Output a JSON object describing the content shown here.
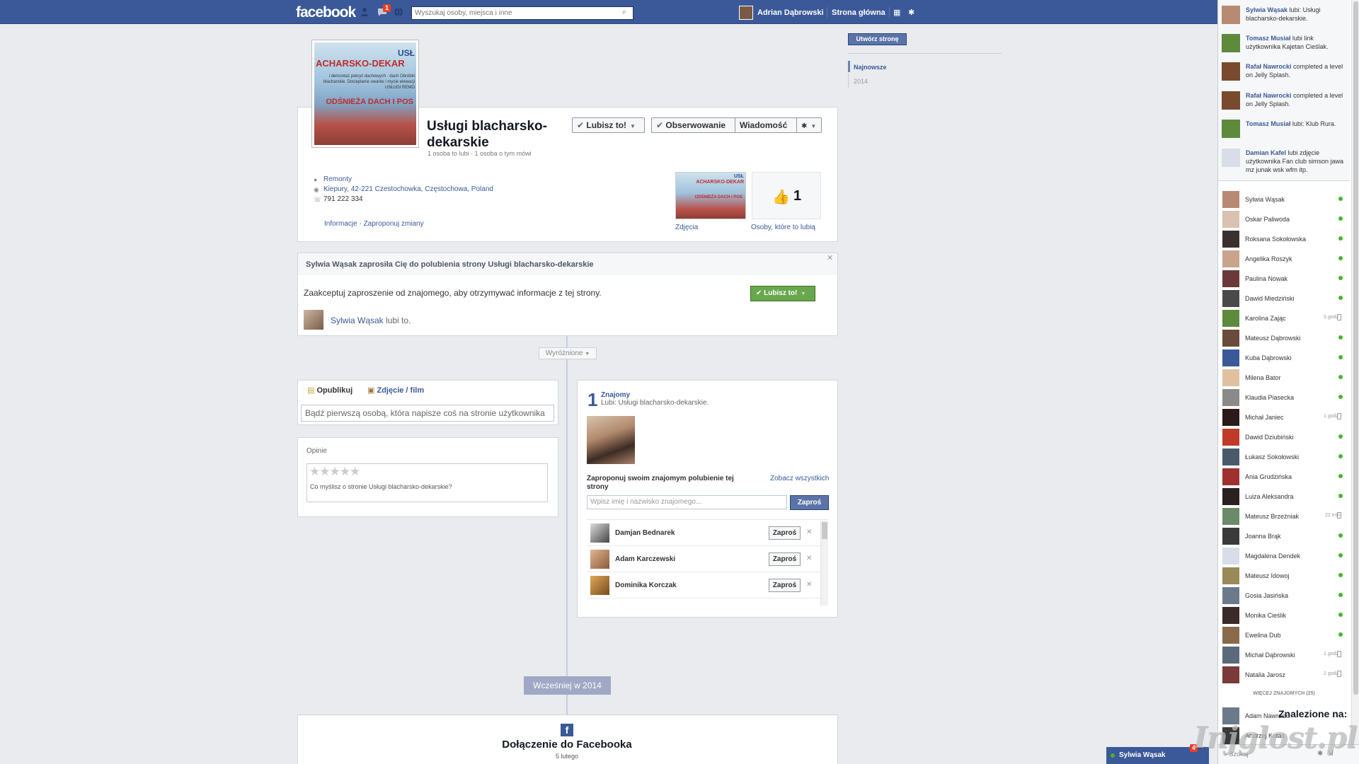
{
  "topbar": {
    "logo": "facebook",
    "notif_count": "1",
    "search_placeholder": "Wyszukaj osoby, miejsca i inne",
    "user_name": "Adrian Dąbrowski",
    "home": "Strona główna"
  },
  "page": {
    "cover_line1": "USŁ",
    "cover_line2": "ACHARSKO-DEKAR",
    "cover_line3": "i demontaż pokryć dachowych · dach Obróbki blacharskie. Docieplanie owanie i mycie elewacji USŁUGI REMO",
    "cover_line4": "ODŚNIEŻA DACH I POS",
    "title": "Usługi blacharsko-dekarskie",
    "subtitle": "1 osoba to lubi · 1 osoba o tym mówi",
    "like_button": "Lubisz to!",
    "follow_button": "Obserwowanie",
    "message_button": "Wiadomość",
    "category": "Remonty",
    "address": "Kiepury, 42-221 Czestochowka, Częstochowa, Poland",
    "phone": "791 222 334",
    "info_link": "Informacje · Zaproponuj zmiany",
    "photos_label": "Zdjęcia",
    "likes_count": "1",
    "likes_label": "Osoby, które to lubią"
  },
  "invite": {
    "header": "Sylwia Wąsak zaprosiła Cię do polubienia strony Usługi blacharsko-dekarskie",
    "text": "Zaakceptuj zaproszenie od znajomego, aby otrzymywać informacje z tej strony.",
    "like_button": "Lubisz to!",
    "inviter_name": "Sylwia Wąsak",
    "inviter_suffix": "lubi to."
  },
  "timeline": {
    "highlights": "Wyróżnione",
    "publish_tab": "Opublikuj",
    "photo_tab": "Zdjęcie / film",
    "post_placeholder": "Bądź pierwszą osobą, która napisze coś na stronie użytkownika",
    "reviews_title": "Opinie",
    "stars": "★★★★★",
    "review_prompt": "Co myślisz o stronie Usługi blacharsko-dekarskie?",
    "earlier": "Wcześniej w 2014",
    "joined_title": "Dołączenie do Facebooka",
    "joined_date": "5 lutego"
  },
  "friends_box": {
    "count": "1",
    "title": "Znajomy",
    "subtitle": "Lubi: Usługi blacharsko-dekarskie.",
    "suggest_label": "Zaproponuj swoim znajomym polubienie tej strony",
    "see_all": "Zobacz wszystkich",
    "search_placeholder": "Wpisz imię i nazwisko znajomego...",
    "invite_button": "Zaproś",
    "rows": [
      {
        "name": "Damjan Bednarek",
        "btn": "Zaproś"
      },
      {
        "name": "Adam Karczewski",
        "btn": "Zaproś"
      },
      {
        "name": "Dominika Korczak",
        "btn": "Zaproś"
      }
    ]
  },
  "rail": {
    "create_page": "Utwórz stronę",
    "latest": "Najnowsze",
    "year": "2014"
  },
  "ticker": [
    {
      "name": "Sylwia Wąsak",
      "text": "lubi: Usługi blacharsko-dekarskie."
    },
    {
      "name": "Tomasz Musiał",
      "text": "lubi link użytkownika Kajetan Cieślak."
    },
    {
      "name": "Rafał Nawrocki",
      "text": "completed a level on Jelly Splash."
    },
    {
      "name": "Rafał Nawrocki",
      "text": "completed a level on Jelly Splash."
    },
    {
      "name": "Tomasz Musiał",
      "text": "lubi: Klub Rura."
    },
    {
      "name": "Damian Kafel",
      "text": "lubi zdjęcie użytkownika Fan club simson jawa mz junak wsk wfm itp."
    }
  ],
  "chat": [
    {
      "name": "Sylwia Wąsak",
      "status": "online",
      "time": ""
    },
    {
      "name": "Oskar Paliwoda",
      "status": "online",
      "time": ""
    },
    {
      "name": "Roksana Sokołowska",
      "status": "online",
      "time": ""
    },
    {
      "name": "Angelika Roszyk",
      "status": "online",
      "time": ""
    },
    {
      "name": "Paulina Nowak",
      "status": "online",
      "time": ""
    },
    {
      "name": "Dawid Miedziński",
      "status": "online",
      "time": ""
    },
    {
      "name": "Karolina Zając",
      "status": "mobile",
      "time": "3 godz."
    },
    {
      "name": "Mateusz Dąbrowski",
      "status": "online",
      "time": ""
    },
    {
      "name": "Kuba Dąbrowski",
      "status": "online",
      "time": ""
    },
    {
      "name": "Milena Bator",
      "status": "online",
      "time": ""
    },
    {
      "name": "Klaudia Piasecka",
      "status": "online",
      "time": ""
    },
    {
      "name": "Michał Janiec",
      "status": "mobile",
      "time": "1 godz."
    },
    {
      "name": "Dawid Dziubiński",
      "status": "online",
      "time": ""
    },
    {
      "name": "Łukasz Sokołowski",
      "status": "online",
      "time": ""
    },
    {
      "name": "Ania Grudzińska",
      "status": "online",
      "time": ""
    },
    {
      "name": "Luiza Aleksandra",
      "status": "online",
      "time": ""
    },
    {
      "name": "Mateusz Brzeźniak",
      "status": "mobile",
      "time": "22 min"
    },
    {
      "name": "Joanna Brąk",
      "status": "online",
      "time": ""
    },
    {
      "name": "Magdalena Dendek",
      "status": "online",
      "time": ""
    },
    {
      "name": "Mateusz Idowoj",
      "status": "online",
      "time": ""
    },
    {
      "name": "Gosia Jasińska",
      "status": "online",
      "time": ""
    },
    {
      "name": "Monika Cieślik",
      "status": "online",
      "time": ""
    },
    {
      "name": "Ewelina Dub",
      "status": "online",
      "time": ""
    },
    {
      "name": "Michał Dąbrowski",
      "status": "mobile",
      "time": "1 godz."
    },
    {
      "name": "Natalia Jarosz",
      "status": "mobile",
      "time": "2 godz."
    }
  ],
  "chat_more": "WIĘCEJ ZNAJOMYCH (25)",
  "chat_more_list": [
    {
      "name": "Adam Nawrocki"
    },
    {
      "name": "Andrzej Kotas"
    }
  ],
  "sidebar_bottom": {
    "search": "Szukaj"
  },
  "chat_tab": {
    "name": "Sylwia Wąsak",
    "badge": "4"
  },
  "overlay_text": "Znalezione na:",
  "watermark": "Injglost.pl",
  "colors": {
    "brand": "#3b5998",
    "online": "#42b72a",
    "like_green": "#69a74e",
    "badge_red": "#f03d25"
  }
}
